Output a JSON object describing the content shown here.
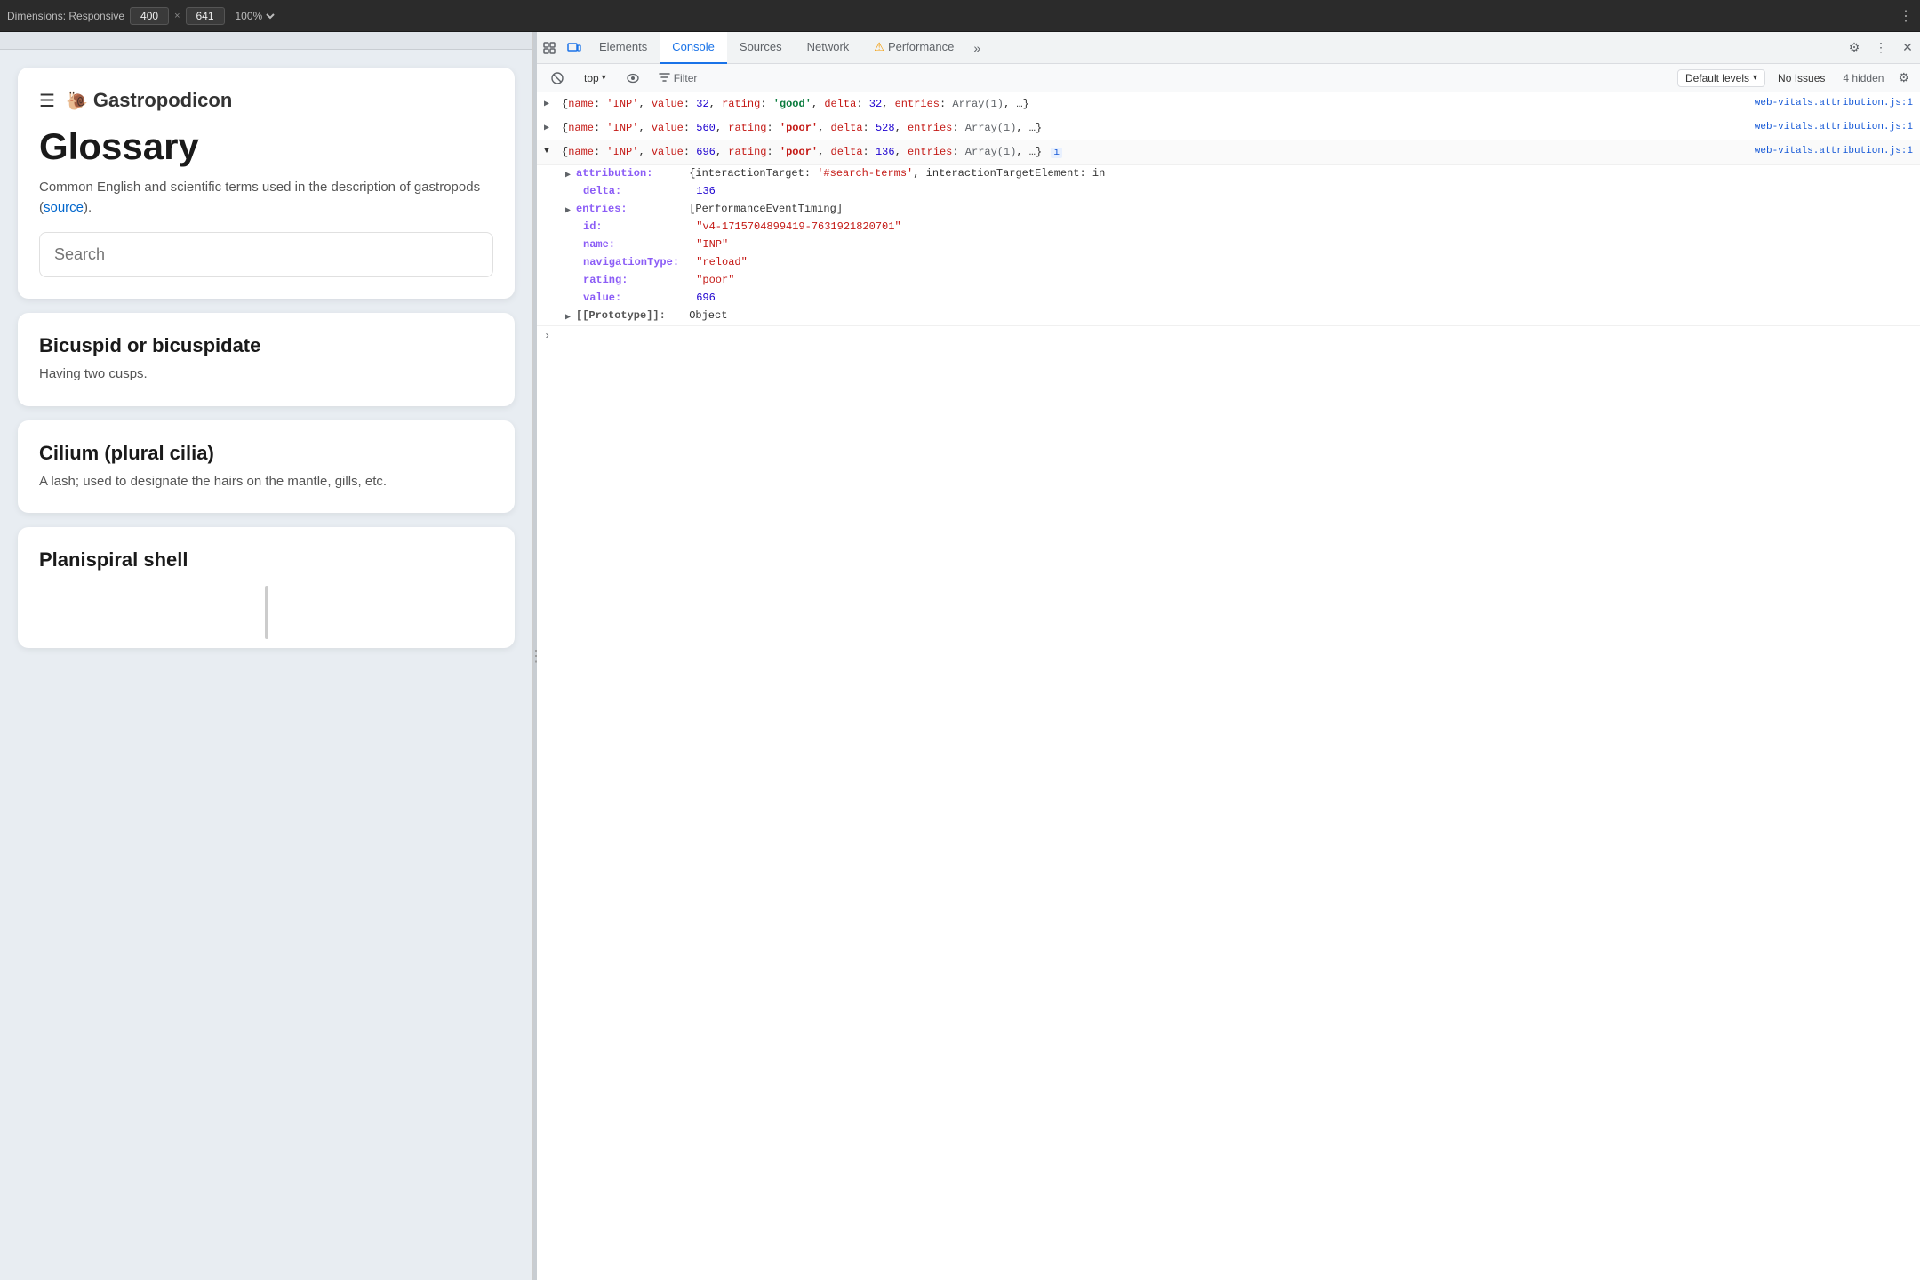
{
  "topbar": {
    "dimensions_label": "Dimensions: Responsive",
    "width": "400",
    "x": "×",
    "height": "641",
    "zoom": "100%",
    "dots": "⋮"
  },
  "webpage": {
    "hamburger": "☰",
    "snail": "🐌",
    "site_name": "Gastropodicon",
    "glossary_title": "Glossary",
    "description": "Common English and scientific terms used in the description of gastropods (",
    "source_link": "source",
    "description_end": ").",
    "search_placeholder": "Search",
    "terms": [
      {
        "term": "Bicuspid or bicuspidate",
        "definition": "Having two cusps."
      },
      {
        "term": "Cilium (plural cilia)",
        "definition": "A lash; used to designate the hairs on the mantle, gills, etc."
      },
      {
        "term": "Planispiral shell",
        "definition": ""
      }
    ]
  },
  "devtools": {
    "tabs": [
      {
        "label": "Elements",
        "active": false
      },
      {
        "label": "Console",
        "active": true
      },
      {
        "label": "Sources",
        "active": false
      },
      {
        "label": "Network",
        "active": false
      },
      {
        "label": "Performance",
        "active": false
      }
    ],
    "overflow_label": "»",
    "toolbar_icons": {
      "inspect": "⬚",
      "toggle": "▭",
      "settings": "⚙",
      "dots": "⋮",
      "close": "✕"
    },
    "secondary": {
      "clear_icon": "🚫",
      "context": "top",
      "context_arrow": "▾",
      "eye_icon": "👁",
      "filter_label": "Filter",
      "levels_label": "Default levels",
      "levels_arrow": "▾",
      "no_issues": "No Issues",
      "hidden": "4 hidden",
      "gear": "⚙"
    },
    "console_rows": [
      {
        "id": "row1",
        "source": "web-vitals.attribution.js:1",
        "collapsed": true,
        "text": "{name: 'INP', value: 32, rating: 'good', delta: 32, entries: Array(1), …}"
      },
      {
        "id": "row2",
        "source": "web-vitals.attribution.js:1",
        "collapsed": true,
        "text": "{name: 'INP', value: 560, rating: 'poor', delta: 528, entries: Array(1), …}"
      },
      {
        "id": "row3",
        "source": "web-vitals.attribution.js:1",
        "collapsed": false,
        "text": "{name: 'INP', value: 696, rating: 'poor', delta: 136, entries: Array(1), …}",
        "expanded_rows": [
          {
            "indent": 1,
            "key": "attribution:",
            "val": "{interactionTarget: '#search-terms', interactionTargetElement: in",
            "val_type": "obj"
          },
          {
            "indent": 2,
            "key": "delta:",
            "val": "136",
            "val_type": "num"
          },
          {
            "indent": 1,
            "key": "entries:",
            "val": "[PerformanceEventTiming]",
            "val_type": "arr"
          },
          {
            "indent": 2,
            "key": "id:",
            "val": "\"v4-1715704899419-7631921820701\"",
            "val_type": "str"
          },
          {
            "indent": 2,
            "key": "name:",
            "val": "\"INP\"",
            "val_type": "str"
          },
          {
            "indent": 2,
            "key": "navigationType:",
            "val": "\"reload\"",
            "val_type": "str"
          },
          {
            "indent": 2,
            "key": "rating:",
            "val": "\"poor\"",
            "val_type": "str"
          },
          {
            "indent": 2,
            "key": "value:",
            "val": "696",
            "val_type": "num"
          },
          {
            "indent": 1,
            "key": "[[Prototype]]:",
            "val": "Object",
            "val_type": "plain"
          }
        ]
      }
    ],
    "prompt_arrow": ">"
  }
}
